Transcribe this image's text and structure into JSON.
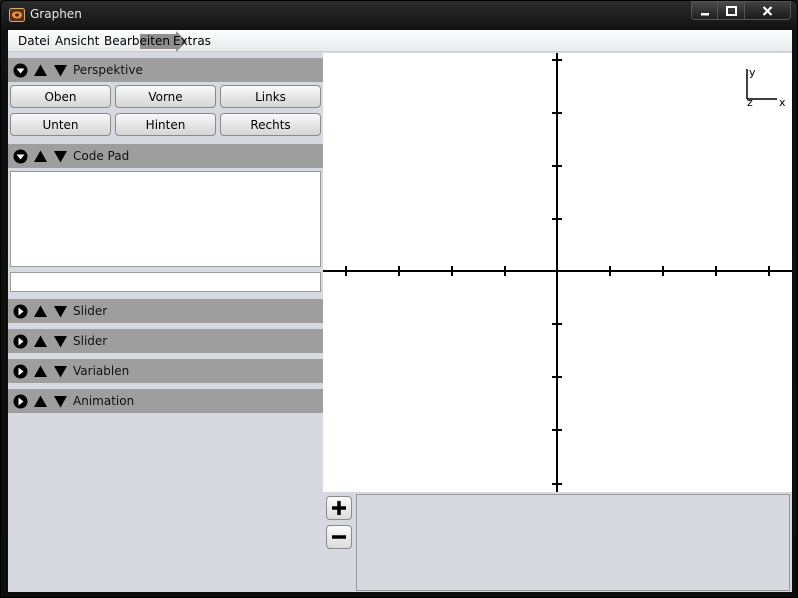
{
  "window": {
    "title": "Graphen",
    "controls": {
      "minimize": "▁",
      "maximize": "□",
      "close": "✕"
    }
  },
  "menu": {
    "items": [
      "Datei",
      "Ansicht",
      "Bearbeiten",
      "Extras"
    ]
  },
  "sections": {
    "perspektive": {
      "label": "Perspektive",
      "buttons": [
        "Oben",
        "Vorne",
        "Links",
        "Unten",
        "Hinten",
        "Rechts"
      ]
    },
    "codepad": {
      "label": "Code Pad",
      "text": "",
      "input_value": ""
    },
    "collapsed": [
      "Slider",
      "Slider",
      "Variablen",
      "Animation"
    ]
  },
  "graph": {
    "axis_labels": {
      "y": "y",
      "z": "z",
      "x": "x"
    }
  },
  "colors": {
    "section_header": "#9e9e9e",
    "panel_bg": "#d6d9e0",
    "plot_bg": "#ffffff"
  }
}
